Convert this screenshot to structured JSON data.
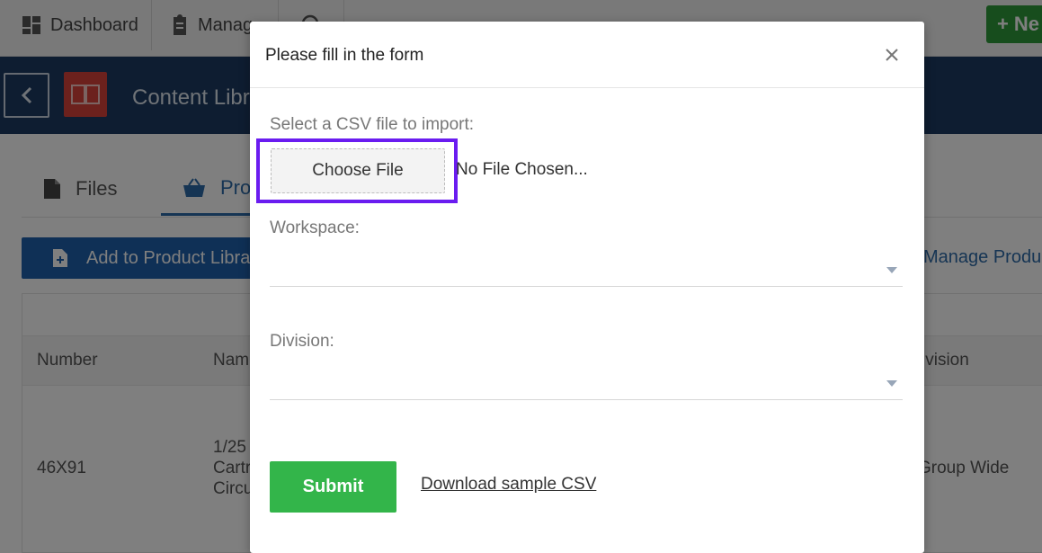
{
  "background": {
    "topnav": {
      "dashboard_label": "Dashboard",
      "manage_label": "Manag",
      "new_label": "Ne"
    },
    "header": {
      "title": "Content Libr"
    },
    "tabs": [
      {
        "label": "Files"
      },
      {
        "label": "Pro"
      }
    ],
    "actions": {
      "add_label": "Add to Product Librar",
      "manage_link": "Manage Produc"
    },
    "table": {
      "headers": [
        "Number",
        "Nam",
        "ivision"
      ],
      "row": {
        "number": "46X91",
        "name_lines": [
          "1/25",
          "Cartr",
          "Circu"
        ],
        "division": "Group Wide"
      }
    }
  },
  "modal": {
    "title": "Please fill in the form",
    "csv_label": "Select a CSV file to import:",
    "choose_file_label": "Choose File",
    "file_status": "No File Chosen...",
    "workspace_label": "Workspace:",
    "workspace_value": "",
    "division_label": "Division:",
    "division_value": "",
    "submit_label": "Submit",
    "download_label": "Download sample CSV"
  },
  "colors": {
    "highlight": "#6a1cf0",
    "submit": "#33b54a",
    "header_bg": "#1d3b63",
    "primary": "#1f61ad"
  }
}
